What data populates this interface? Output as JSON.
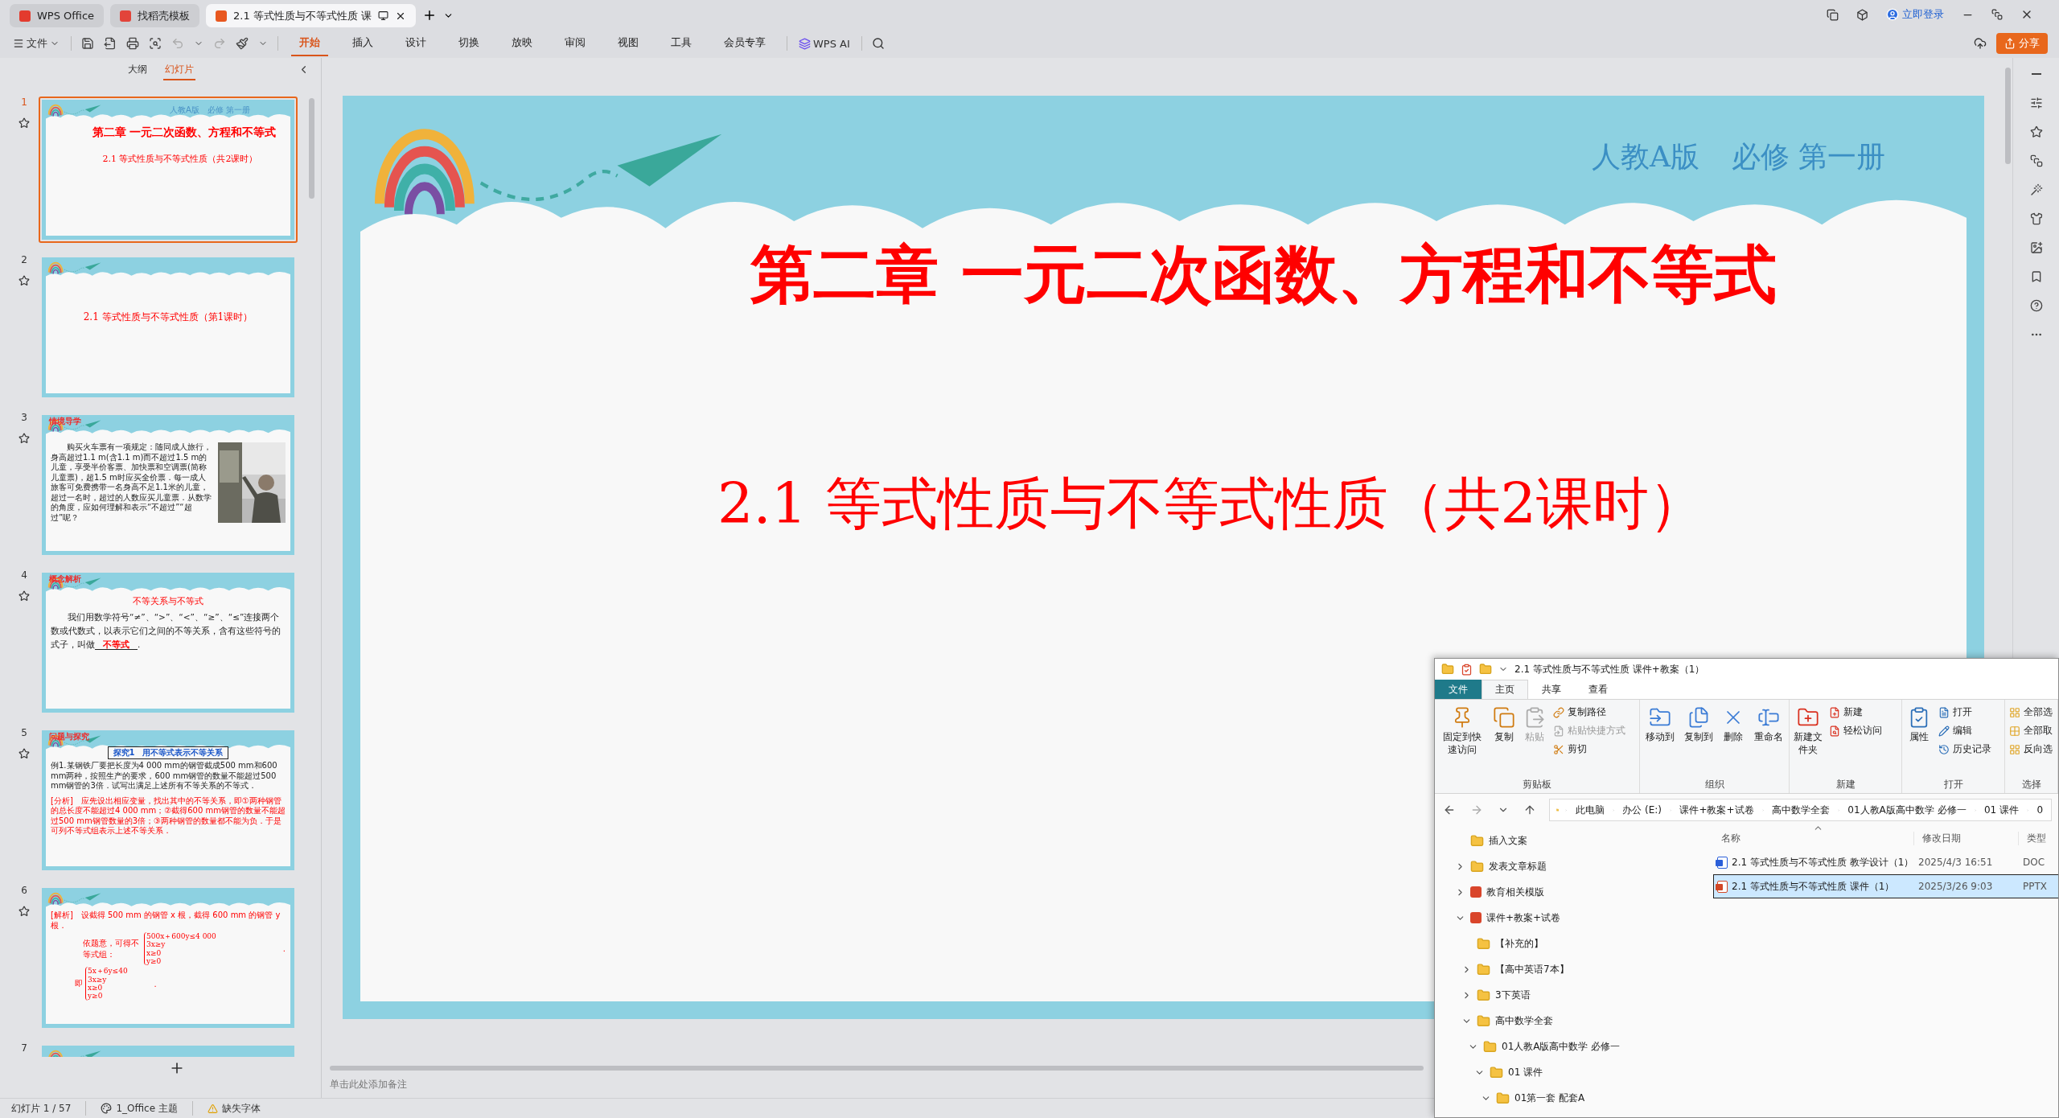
{
  "tabs": [
    {
      "label": "WPS Office",
      "kind": "home",
      "selected": false
    },
    {
      "label": "找稻壳模板",
      "kind": "template",
      "selected": false
    },
    {
      "label": "2.1 等式性质与不等式性质 课",
      "kind": "document",
      "selected": true
    }
  ],
  "account": "立即登录",
  "menu": {
    "file": "文件",
    "items": [
      {
        "label": "开始",
        "selected": true
      },
      {
        "label": "插入",
        "selected": false
      },
      {
        "label": "设计",
        "selected": false
      },
      {
        "label": "切换",
        "selected": false
      },
      {
        "label": "放映",
        "selected": false
      },
      {
        "label": "审阅",
        "selected": false
      },
      {
        "label": "视图",
        "selected": false
      },
      {
        "label": "工具",
        "selected": false
      },
      {
        "label": "会员专享",
        "selected": false
      }
    ],
    "ai": "WPS AI"
  },
  "share": "分享",
  "panel_tabs": [
    {
      "label": "大纲",
      "selected": false
    },
    {
      "label": "幻灯片",
      "selected": true
    }
  ],
  "slides": [
    {
      "number": "1",
      "selected": true,
      "kind": "title",
      "edition": "人教A版",
      "volume": "必修 第一册",
      "title": "第二章 一元二次函数、方程和不等式",
      "subtitle": "2.1 等式性质与不等式性质（共2课时）"
    },
    {
      "number": "2",
      "selected": false,
      "kind": "section",
      "subtitle": "2.1 等式性质与不等式性质（第1课时）"
    },
    {
      "number": "3",
      "selected": false,
      "kind": "story",
      "label": "情境导学",
      "text": "购买火车票有一项规定：随同成人旅行，身高超过1.1 m(含1.1 m)而不超过1.5 m的儿童，享受半价客票、加快票和空调票(简称儿童票)，超1.5 m时应买全价票．每一成人旅客可免费携带一名身高不足1.1米的儿童，超过一名时，超过的人数应买儿童票．从数学的角度，应如何理解和表示“不超过”“超过”呢？"
    },
    {
      "number": "4",
      "selected": false,
      "kind": "definition",
      "label": "概念解析",
      "title": "不等关系与不等式",
      "text": "我们用数学符号“≠”、“>”、“<”、“≥”、“≤”连接两个数或代数式，以表示它们之间的不等关系，含有这些符号的式子，叫做",
      "answer": "不等式",
      "end": "."
    },
    {
      "number": "5",
      "selected": false,
      "kind": "example",
      "label": "问题与探究",
      "box": "探究1　用不等式表示不等关系",
      "text": "例1.某钢铁厂要把长度为4 000 mm的钢管截成500 mm和600 mm两种，按照生产的要求，600 mm钢管的数量不能超过500 mm钢管的3倍．试写出满足上述所有不等关系的不等式．",
      "analysis": "[分析]　应先设出相应变量，找出其中的不等关系，即①两种钢管的总长度不能超过4 000 mm；②截得600 mm钢管的数量不能超过500 mm钢管数量的3倍；③两种钢管的数量都不能为负．于是可列不等式组表示上述不等关系．"
    },
    {
      "number": "6",
      "selected": false,
      "kind": "solution",
      "text": "[解析]　设截得 500 mm 的钢管 x 根，截得 600 mm 的钢管 y 根．",
      "lead": "依题意，可得不等式组：",
      "system": [
        "500x＋600y≤4 000",
        "3x≥y",
        "x≥0",
        "y≥0"
      ],
      "system_end": ".",
      "lead2": "即",
      "system2": [
        "5x＋6y≤40",
        "3x≥y",
        "x≥0",
        "y≥0"
      ],
      "system2_end": "."
    },
    {
      "number": "7",
      "selected": false,
      "kind": "blank"
    }
  ],
  "editor": {
    "edition": "人教A版",
    "volume": "必修 第一册",
    "title": "第二章 一元二次函数、方程和不等式",
    "subtitle": "2.1 等式性质与不等式性质（共2课时）",
    "notes_placeholder": "单击此处添加备注"
  },
  "status_bar": {
    "slide": "幻灯片 1 / 57",
    "theme": "1_Office 主题",
    "warning": "缺失字体"
  },
  "explorer": {
    "title": "2.1 等式性质与不等式性质 课件+教案（1）",
    "tabs": [
      {
        "label": "文件",
        "kind": "file",
        "selected": false
      },
      {
        "label": "主页",
        "kind": "tab",
        "selected": true
      },
      {
        "label": "共享",
        "kind": "tab",
        "selected": false
      },
      {
        "label": "查看",
        "kind": "tab",
        "selected": false
      }
    ],
    "ribbon": [
      {
        "label": "剪贴板",
        "buttons": [
          {
            "label": "固定到快速访问",
            "kind": "large",
            "disabled": false
          },
          {
            "label": "复制",
            "kind": "large",
            "disabled": false
          },
          {
            "label": "粘贴",
            "kind": "large",
            "disabled": true
          },
          {
            "label": "复制路径",
            "kind": "small",
            "disabled": false
          },
          {
            "label": "粘贴快捷方式",
            "kind": "small",
            "disabled": true
          },
          {
            "label": "剪切",
            "kind": "small",
            "disabled": false
          }
        ]
      },
      {
        "label": "组织",
        "buttons": [
          {
            "label": "移动到",
            "kind": "large",
            "disabled": false
          },
          {
            "label": "复制到",
            "kind": "large",
            "disabled": false
          },
          {
            "label": "删除",
            "kind": "large",
            "disabled": false
          },
          {
            "label": "重命名",
            "kind": "large",
            "disabled": false
          }
        ]
      },
      {
        "label": "新建",
        "buttons": [
          {
            "label": "新建文件夹",
            "kind": "large",
            "disabled": false
          },
          {
            "label": "新建",
            "kind": "small",
            "disabled": false
          },
          {
            "label": "轻松访问",
            "kind": "small",
            "disabled": false
          }
        ]
      },
      {
        "label": "打开",
        "buttons": [
          {
            "label": "属性",
            "kind": "large",
            "disabled": false
          },
          {
            "label": "打开",
            "kind": "small",
            "disabled": false
          },
          {
            "label": "编辑",
            "kind": "small",
            "disabled": false
          },
          {
            "label": "历史记录",
            "kind": "small",
            "disabled": false
          }
        ]
      },
      {
        "label": "选择",
        "buttons": [
          {
            "label": "全部选",
            "kind": "small",
            "disabled": false
          },
          {
            "label": "全部取",
            "kind": "small",
            "disabled": false
          },
          {
            "label": "反向选",
            "kind": "small",
            "disabled": false
          }
        ]
      }
    ],
    "path": [
      "此电脑",
      "办公 (E:)",
      "课件+教案+试卷",
      "高中数学全套",
      "01人教A版高中数学 必修一",
      "01 课件",
      "0"
    ],
    "tree": [
      {
        "label": "插入文案",
        "kind": "folder"
      },
      {
        "label": "发表文章标题",
        "kind": "folder",
        "expanded": false
      },
      {
        "label": "教育相关模版",
        "kind": "app",
        "expanded": false
      },
      {
        "label": "课件+教案+试卷",
        "kind": "app",
        "expanded": true,
        "children": [
          {
            "label": "【补充的】",
            "kind": "folder"
          },
          {
            "label": "【高中英语7本】",
            "kind": "folder",
            "expanded": false
          },
          {
            "label": "3下英语",
            "kind": "folder",
            "expanded": false
          },
          {
            "label": "高中数学全套",
            "kind": "folder",
            "expanded": true,
            "children": [
              {
                "label": "01人教A版高中数学 必修一",
                "kind": "folder",
                "expanded": true,
                "children": [
                  {
                    "label": "01 课件",
                    "kind": "folder",
                    "expanded": true,
                    "children": [
                      {
                        "label": "01第一套 配套A",
                        "kind": "folder",
                        "expanded": true
                      }
                    ]
                  }
                ]
              }
            ]
          }
        ]
      }
    ],
    "columns": [
      "名称",
      "修改日期",
      "类型"
    ],
    "files": [
      {
        "name": "2.1 等式性质与不等式性质 教学设计（1）",
        "kind": "doc",
        "date": "2025/4/3 16:51",
        "type": "DOC",
        "selected": false
      },
      {
        "name": "2.1 等式性质与不等式性质 课件（1）",
        "kind": "ppt",
        "date": "2025/3/26 9:03",
        "type": "PPTX",
        "selected": true
      }
    ]
  }
}
